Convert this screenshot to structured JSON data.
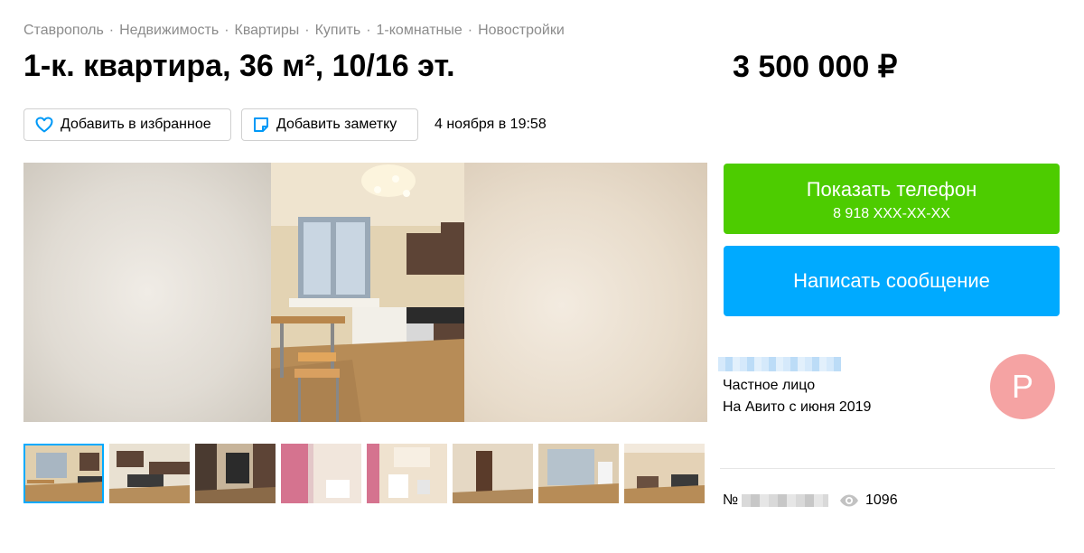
{
  "breadcrumbs": [
    "Ставрополь",
    "Недвижимость",
    "Квартиры",
    "Купить",
    "1-комнатные",
    "Новостройки"
  ],
  "breadcrumb_separator": "·",
  "title": "1-к. квартира, 36 м², 10/16 эт.",
  "price": "3 500 000 ₽",
  "actions": {
    "favorite_label": "Добавить в избранное",
    "note_label": "Добавить заметку",
    "date": "4 ноября в 19:58"
  },
  "contact": {
    "show_phone_label": "Показать телефон",
    "phone_masked": "8 918 XXX-XX-XX",
    "write_message_label": "Написать сообщение"
  },
  "seller": {
    "type": "Частное лицо",
    "since": "На Авито с июня 2019",
    "avatar_letter": "Р"
  },
  "ad": {
    "number_prefix": "№",
    "views": "1096"
  },
  "colors": {
    "green": "#4dcc00",
    "blue": "#00aaff",
    "avatar": "#f5a3a3"
  }
}
